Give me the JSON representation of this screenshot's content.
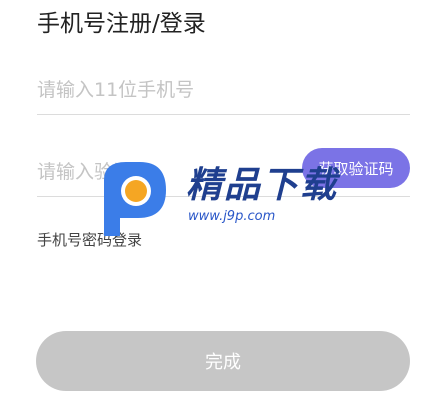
{
  "header": {
    "title": "手机号注册/登录"
  },
  "form": {
    "phone_placeholder": "请输入11位手机号",
    "phone_value": "",
    "code_placeholder": "请输入验证码",
    "code_value": "",
    "get_code_label": "获取验证码",
    "password_login_label": "手机号密码登录",
    "done_label": "完成"
  },
  "watermark": {
    "brand": "精品下载",
    "url": "www.j9p.com"
  },
  "colors": {
    "accent": "#7b73e6",
    "disabled_button": "#c6c6c6",
    "watermark_blue": "#1f3f8f",
    "watermark_orange": "#f5a623"
  }
}
